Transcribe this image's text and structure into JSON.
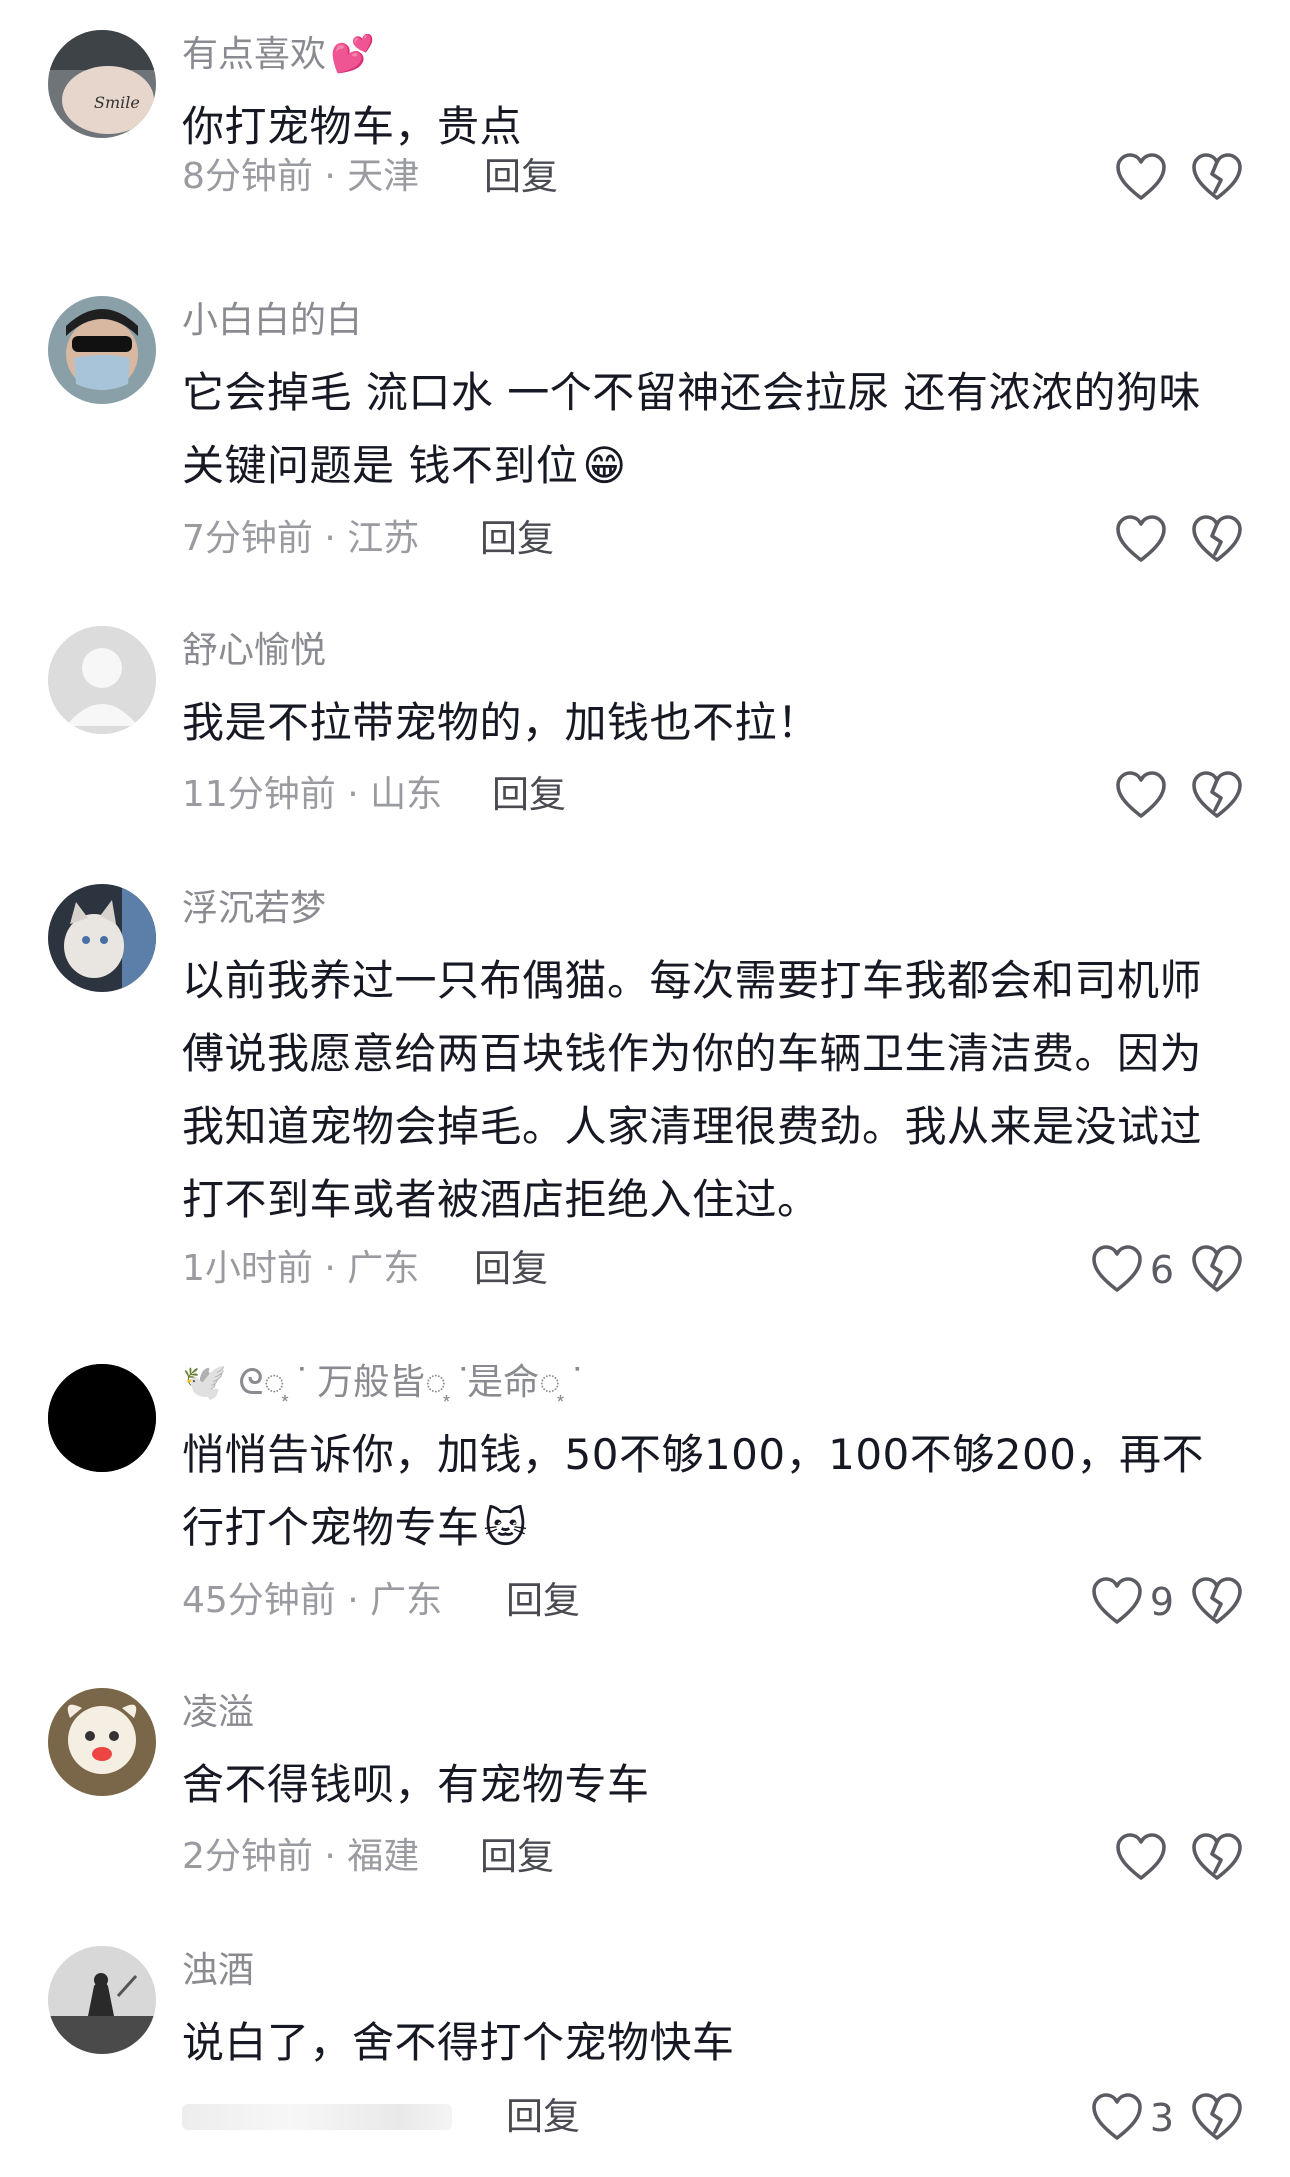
{
  "reply_label": "回复",
  "comments": [
    {
      "username": "有点喜欢",
      "username_emoji": "💕",
      "text": "你打宠物车，贵点",
      "meta": "8分钟前 · 天津",
      "likes": ""
    },
    {
      "username": "小白白的白",
      "text_line1": "它会掉毛 流口水 一个不留神还会拉尿 还有浓浓的狗味",
      "text_line2": "关键问题是 钱不到位",
      "text_emoji": "😁",
      "meta": "7分钟前 · 江苏",
      "likes": ""
    },
    {
      "username": "舒心愉悦",
      "text": "我是不拉带宠物的，加钱也不拉！",
      "meta": "11分钟前 · 山东",
      "likes": ""
    },
    {
      "username": "浮沉若梦",
      "text_line1": "以前我养过一只布偶猫。每次需要打车我都会和司机师",
      "text_line2": "傅说我愿意给两百块钱作为你的车辆卫生清洁费。因为",
      "text_line3": "我知道宠物会掉毛。人家清理很费劲。我从来是没试过",
      "text_line4": "打不到车或者被酒店拒绝入住过。",
      "meta": "1小时前 · 广东",
      "likes": "6"
    },
    {
      "username": "🕊️ ᘓ◌͙ ᐝ 万般皆◌͙ ᐝ是命◌͙ ᐝ",
      "text_line1": "悄悄告诉你，加钱，50不够100，100不够200，再不",
      "text_line2": "行打个宠物专车",
      "text_emoji": "🐱",
      "meta": "45分钟前 · 广东",
      "likes": "9"
    },
    {
      "username": "凌溢",
      "text": "舍不得钱呗，有宠物专车",
      "meta": "2分钟前 · 福建",
      "likes": ""
    },
    {
      "username": "浊酒",
      "text": "说白了，舍不得打个宠物快车",
      "meta": "",
      "likes": "3"
    }
  ],
  "colors": {
    "text": "#161823",
    "username": "#8a8b91",
    "meta": "#9a9ba0",
    "icon_stroke": "#5b5c63"
  },
  "icons": {
    "like": "heart-outline-icon",
    "dislike": "broken-heart-icon"
  }
}
